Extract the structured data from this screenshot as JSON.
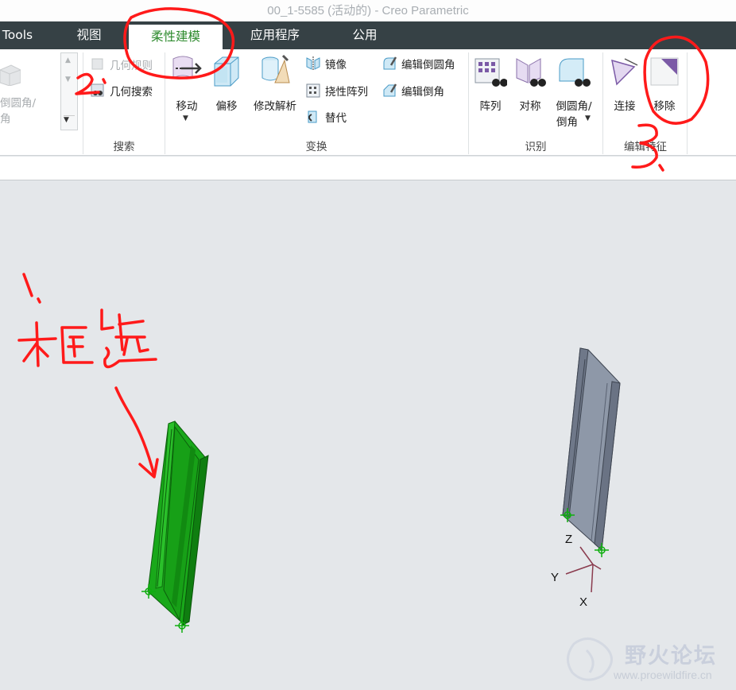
{
  "window": {
    "title": "00_1-5585 (活动的) - Creo Parametric"
  },
  "tabs": [
    {
      "label": "Tools"
    },
    {
      "label": "视图"
    },
    {
      "label": "柔性建模"
    },
    {
      "label": "应用程序"
    },
    {
      "label": "公用"
    }
  ],
  "ribbon": {
    "shape": {
      "label_line1": "倒圆角/",
      "label_line2": "角"
    },
    "search": {
      "group_label": "搜索",
      "geometry_rule": "几何规则",
      "geometry_search": "几何搜索"
    },
    "transform": {
      "group_label": "变换",
      "move": "移动",
      "offset": "偏移",
      "modify_analytic": "修改解析",
      "mirror": "镜像",
      "flexible_pattern": "挠性阵列",
      "substitute": "替代",
      "edit_round": "编辑倒圆角",
      "edit_chamfer": "编辑倒角"
    },
    "recognize": {
      "group_label": "识别",
      "pattern": "阵列",
      "symmetry": "对称",
      "round_chamfer_line1": "倒圆角/",
      "round_chamfer_line2": "倒角"
    },
    "edit_features": {
      "group_label": "编辑特征",
      "attach": "连接",
      "remove": "移除"
    }
  },
  "viewport": {
    "axes": {
      "z": "Z",
      "y": "Y",
      "x": "X"
    }
  },
  "annotations": {
    "step1_number": "1.",
    "step1_text": "框选",
    "step2_number": "2.",
    "step3_number": "3."
  },
  "watermark": {
    "text": "野火论坛",
    "url": "www.proewildfire.cn"
  },
  "colors": {
    "tab_bar": "#364145",
    "active_tab_text": "#2d8a2d",
    "selected_part": "#1faa1f",
    "part_gray": "#8e98a8",
    "annotation_red": "#ff1a1a"
  }
}
